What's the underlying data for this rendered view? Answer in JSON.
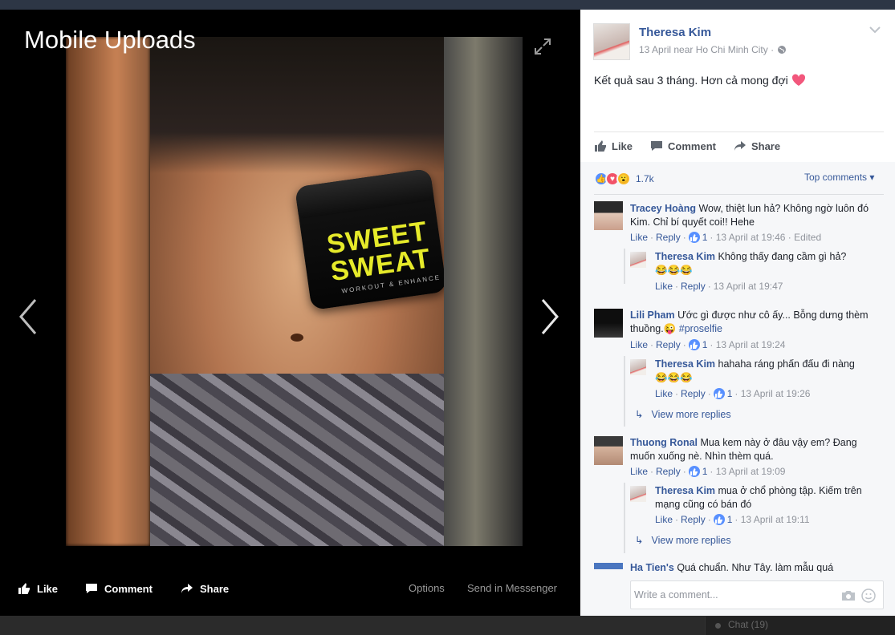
{
  "viewer": {
    "title": "Mobile Uploads",
    "photo_label": "SWEET SWEAT",
    "photo_label_1": "SWEET",
    "photo_label_2": "SWEAT",
    "photo_label_sub": "WORKOUT & ENHANCE",
    "bar": {
      "like": "Like",
      "comment": "Comment",
      "share": "Share",
      "options": "Options",
      "send": "Send in Messenger"
    }
  },
  "background": {
    "chat": "Chat (19)"
  },
  "post": {
    "author": "Theresa Kim",
    "date": "13 April near Ho Chi Minh City ·",
    "text": "Kết quả sau 3 tháng. Hơn cả mong đợi",
    "actions": {
      "like": "Like",
      "comment": "Comment",
      "share": "Share"
    },
    "reaction_count": "1.7k",
    "sort": "Top comments"
  },
  "comments": [
    {
      "name": "Tracey Hoàng",
      "text": "Wow, thiệt lun hả? Không ngờ luôn đó Kim. Chỉ bí quyết coi!! Hehe",
      "like": "Like",
      "reply": "Reply",
      "likes": "1",
      "time": "· 13 April at 19:46 · Edited",
      "reply_item": {
        "name": "Theresa Kim",
        "text": "Không thấy đang cầm gì hả?",
        "emoji": "😂😂😂",
        "like": "Like",
        "reply": "Reply",
        "time": "13 April at 19:47"
      }
    },
    {
      "name": "Lili Pham",
      "text": "Ước gì được như cô ấy... Bỗng dưng thèm thuồng.",
      "emoji": "😜",
      "tag": "#proselfie",
      "like": "Like",
      "reply": "Reply",
      "likes": "1",
      "time": "· 13 April at 19:24",
      "reply_item": {
        "name": "Theresa Kim",
        "text": "hahaha ráng phấn đấu đi nàng",
        "emoji": "😂😂😂",
        "like": "Like",
        "reply": "Reply",
        "likes": "1",
        "time": "· 13 April at 19:26"
      },
      "more": "View more replies"
    },
    {
      "name": "Thuong Ronal",
      "text": "Mua kem này ở đâu vậy em? Đang muốn xuống nè. Nhìn thèm quá.",
      "like": "Like",
      "reply": "Reply",
      "likes": "1",
      "time": "· 13 April at 19:09",
      "reply_item": {
        "name": "Theresa Kim",
        "text": "mua ở chổ phòng tập. Kiếm trên mạng cũng có bán đó",
        "like": "Like",
        "reply": "Reply",
        "likes": "1",
        "time": "· 13 April at 19:11"
      },
      "more": "View more replies"
    },
    {
      "name": "Ha Tien's",
      "text": "Quá chuẩn. Như Tây. làm mẫu quá"
    }
  ],
  "composer": {
    "placeholder": "Write a comment..."
  },
  "colors": {
    "link": "#365899",
    "meta": "#90949c",
    "viewer_bg": "#000000"
  }
}
